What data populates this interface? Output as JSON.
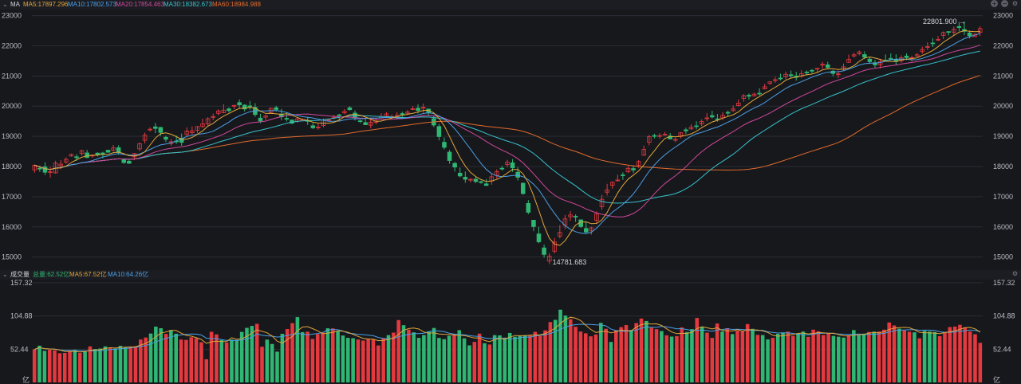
{
  "top_legend": {
    "collapse": "⌄",
    "name": "MA",
    "ma5": "MA5:17897.296",
    "ma10": "MA10:17802.573",
    "ma20": "MA20:17854.463",
    "ma30": "MA30:18382.673",
    "ma60": "MA60:18984.988"
  },
  "bottom_legend": {
    "collapse": "⌄",
    "name": "成交量",
    "total": "总量:62.52亿",
    "ma5": "MA5:67.52亿",
    "ma10": "MA10:64.26亿"
  },
  "colors": {
    "up": "#e3393f",
    "down": "#2fb672",
    "ma5": "#e0a63a",
    "ma10": "#4aa0e8",
    "ma20": "#d0479c",
    "ma30": "#35c2cc",
    "ma60": "#e26a2c",
    "background": "#17181c",
    "grid": "#2a2c33"
  },
  "icons": [
    "plus-circle-icon",
    "minus-circle-icon",
    "settings-icon"
  ],
  "chart_data": [
    {
      "type": "candlestick",
      "y_ticks": [
        "23000",
        "22000",
        "21000",
        "20000",
        "19000",
        "18000",
        "17000",
        "16000",
        "15000"
      ],
      "ylim": [
        14700,
        23200
      ],
      "high_label": "22801.900",
      "low_label": "14781.683",
      "candles": [
        [
          17888,
          18041,
          17796,
          18071
        ],
        [
          17941,
          17932,
          17823,
          18022
        ],
        [
          17986,
          17810,
          17719,
          18140
        ],
        [
          17824,
          17827,
          17629,
          17989
        ],
        [
          17789,
          18110,
          17762,
          18190
        ],
        [
          18027,
          18079,
          17917,
          18213
        ],
        [
          18148,
          18236,
          18095,
          18306
        ],
        [
          18347,
          18400,
          18325,
          18426
        ],
        [
          18323,
          18293,
          18186,
          18409
        ],
        [
          18428,
          18525,
          18361,
          18558
        ],
        [
          18450,
          18298,
          18277,
          18551
        ],
        [
          18347,
          18373,
          18293,
          18397
        ],
        [
          18444,
          18393,
          18332,
          18469
        ],
        [
          18447,
          18445,
          18269,
          18488
        ],
        [
          18539,
          18472,
          18457,
          18551
        ],
        [
          18543,
          18613,
          18489,
          18712
        ],
        [
          18622,
          18460,
          18391,
          18705
        ],
        [
          18222,
          18131,
          18089,
          18263
        ],
        [
          18176,
          18105,
          18087,
          18242
        ],
        [
          18319,
          18426,
          18210,
          18447
        ],
        [
          18583,
          18755,
          18510,
          18798
        ],
        [
          18868,
          19036,
          18763,
          19122
        ],
        [
          19211,
          19236,
          19160,
          19292
        ],
        [
          19314,
          19261,
          19101,
          19443
        ],
        [
          19294,
          19129,
          19016,
          19315
        ],
        [
          18968,
          18902,
          18810,
          19020
        ],
        [
          18761,
          18820,
          18684,
          18910
        ],
        [
          18841,
          18837,
          18748,
          19026
        ],
        [
          18938,
          18801,
          18687,
          19091
        ],
        [
          19056,
          19174,
          19002,
          19298
        ],
        [
          19122,
          19183,
          19046,
          19327
        ],
        [
          19203,
          19324,
          19101,
          19339
        ],
        [
          19324,
          19415,
          19276,
          19584
        ],
        [
          19411,
          19583,
          19348,
          19631
        ],
        [
          19630,
          19653,
          19529,
          19750
        ],
        [
          19761,
          19840,
          19689,
          19892
        ],
        [
          19785,
          19868,
          19766,
          20062
        ],
        [
          19910,
          19851,
          19791,
          19957
        ],
        [
          20022,
          20024,
          19900,
          20049
        ],
        [
          20118,
          20042,
          19938,
          20221
        ],
        [
          20034,
          19905,
          19822,
          20064
        ],
        [
          20009,
          19981,
          19882,
          20174
        ],
        [
          19960,
          19723,
          19650,
          20099
        ],
        [
          19604,
          19506,
          19435,
          19745
        ],
        [
          19635,
          19678,
          19532,
          19718
        ],
        [
          19789,
          19926,
          19753,
          19950
        ],
        [
          19948,
          19888,
          19829,
          20012
        ],
        [
          19738,
          19646,
          19537,
          19909
        ],
        [
          19594,
          19593,
          19492,
          19791
        ],
        [
          19538,
          19436,
          19405,
          19561
        ],
        [
          19497,
          19577,
          19452,
          19618
        ],
        [
          19514,
          19550,
          19505,
          19590
        ],
        [
          19527,
          19495,
          19377,
          19640
        ],
        [
          19350,
          19281,
          19241,
          19440
        ],
        [
          19304,
          19305,
          19223,
          19426
        ],
        [
          19355,
          19545,
          19297,
          19592
        ],
        [
          19524,
          19550,
          19518,
          19578
        ],
        [
          19625,
          19630,
          19568,
          19713
        ],
        [
          19712,
          19687,
          19522,
          19740
        ],
        [
          19776,
          19824,
          19730,
          19905
        ],
        [
          19947,
          19882,
          19856,
          19995
        ],
        [
          19769,
          19613,
          19525,
          19856
        ],
        [
          19515,
          19494,
          19441,
          19538
        ],
        [
          19456,
          19384,
          19374,
          19611
        ],
        [
          19370,
          19471,
          19259,
          19563
        ],
        [
          19461,
          19509,
          19396,
          19612
        ],
        [
          19604,
          19662,
          19609,
          19766
        ],
        [
          19661,
          19742,
          19634,
          19803
        ],
        [
          19620,
          19656,
          19561,
          19723
        ],
        [
          19654,
          19698,
          19564,
          19803
        ],
        [
          19753,
          19747,
          19647,
          19821
        ],
        [
          19764,
          19803,
          19704,
          19870
        ],
        [
          19891,
          19916,
          19866,
          19998
        ],
        [
          19933,
          19859,
          19757,
          20060
        ],
        [
          19926,
          19969,
          19785,
          20084
        ],
        [
          19904,
          19774,
          19674,
          19911
        ],
        [
          19584,
          19373,
          19308,
          19676
        ],
        [
          19325,
          18992,
          18868,
          19413
        ],
        [
          18802,
          18635,
          18565,
          18960
        ],
        [
          18475,
          18198,
          18089,
          18549
        ],
        [
          18103,
          17981,
          17833,
          18154
        ],
        [
          17779,
          17687,
          17641,
          17962
        ],
        [
          17646,
          17577,
          17459,
          17834
        ],
        [
          17559,
          17573,
          17475,
          17615
        ],
        [
          17581,
          17502,
          17454,
          17646
        ],
        [
          17496,
          17492,
          17432,
          17533
        ],
        [
          17425,
          17374,
          17351,
          17582
        ],
        [
          17519,
          17658,
          17393,
          17777
        ],
        [
          17705,
          17828,
          17591,
          17906
        ],
        [
          17942,
          17934,
          17862,
          18015
        ],
        [
          18066,
          18141,
          17975,
          18218
        ],
        [
          18121,
          17955,
          17823,
          18245
        ],
        [
          17809,
          17643,
          17537,
          17977
        ],
        [
          17446,
          17102,
          17067,
          17471
        ],
        [
          16777,
          16483,
          16419,
          16887
        ],
        [
          16219,
          16010,
          15857,
          16228
        ],
        [
          15766,
          15503,
          15459,
          15993
        ],
        [
          15303,
          15087,
          14982,
          15414
        ],
        [
          14866,
          15029,
          14764,
          15124
        ],
        [
          15193,
          15497,
          15122,
          15625
        ],
        [
          15693,
          15814,
          15619,
          16063
        ],
        [
          16053,
          16264,
          15928,
          16395
        ],
        [
          16335,
          16394,
          16200,
          16519
        ],
        [
          16351,
          16324,
          16166,
          16411
        ],
        [
          16233,
          16010,
          15964,
          16244
        ],
        [
          15946,
          15829,
          15793,
          16167
        ],
        [
          15867,
          15966,
          15742,
          16004
        ],
        [
          16214,
          16438,
          16125,
          16512
        ],
        [
          16670,
          16915,
          16561,
          17057
        ],
        [
          17148,
          17226,
          17040,
          17424
        ],
        [
          17378,
          17476,
          17265,
          17506
        ],
        [
          17538,
          17552,
          17500,
          17730
        ],
        [
          17722,
          17716,
          17555,
          17805
        ],
        [
          17824,
          17940,
          17780,
          18012
        ],
        [
          17931,
          17885,
          17785,
          18040
        ],
        [
          18041,
          18162,
          17955,
          18212
        ],
        [
          18375,
          18563,
          18349,
          18692
        ],
        [
          18801,
          18985,
          18698,
          19046
        ],
        [
          19025,
          19004,
          18932,
          19087
        ],
        [
          18998,
          19024,
          18926,
          19103
        ],
        [
          19050,
          19067,
          19018,
          19144
        ],
        [
          19011,
          18913,
          18898,
          19108
        ],
        [
          18881,
          18897,
          18809,
          18956
        ],
        [
          18996,
          19116,
          18927,
          19139
        ],
        [
          19215,
          19180,
          19080,
          19285
        ],
        [
          19245,
          19304,
          19217,
          19400
        ],
        [
          19347,
          19334,
          19233,
          19497
        ],
        [
          19413,
          19490,
          19338,
          19561
        ],
        [
          19583,
          19611,
          19501,
          19767
        ],
        [
          19687,
          19641,
          19591,
          19848
        ],
        [
          19577,
          19575,
          19485,
          19741
        ],
        [
          19609,
          19692,
          19544,
          19797
        ],
        [
          19795,
          19766,
          19648,
          19855
        ],
        [
          19852,
          19907,
          19811,
          20024
        ],
        [
          20017,
          20099,
          19992,
          20219
        ],
        [
          20253,
          20347,
          20144,
          20399
        ],
        [
          20361,
          20327,
          20216,
          20421
        ],
        [
          20342,
          20398,
          20320,
          20447
        ],
        [
          20428,
          20414,
          20353,
          20589
        ],
        [
          20570,
          20642,
          20556,
          20740
        ],
        [
          20750,
          20805,
          20708,
          20820
        ],
        [
          20847,
          20876,
          20776,
          20969
        ],
        [
          20930,
          20912,
          20853,
          21076
        ],
        [
          20970,
          21056,
          20890,
          21145
        ],
        [
          21041,
          21004,
          20939,
          21181
        ],
        [
          20998,
          20955,
          20844,
          21134
        ],
        [
          20989,
          21076,
          20942,
          21191
        ],
        [
          21128,
          21114,
          21024,
          21182
        ],
        [
          21186,
          21176,
          21088,
          21230
        ],
        [
          21225,
          21252,
          21114,
          21269
        ],
        [
          21360,
          21385,
          21241,
          21465
        ],
        [
          21367,
          21286,
          21224,
          21469
        ],
        [
          21160,
          21083,
          20987,
          21200
        ],
        [
          21045,
          21071,
          20930,
          21181
        ],
        [
          21225,
          21301,
          21174,
          21410
        ],
        [
          21453,
          21550,
          21431,
          21710
        ],
        [
          21663,
          21701,
          21608,
          21770
        ],
        [
          21733,
          21798,
          21686,
          21844
        ],
        [
          21708,
          21624,
          21558,
          21815
        ],
        [
          21557,
          21472,
          21396,
          21637
        ],
        [
          21439,
          21367,
          21272,
          21536
        ],
        [
          21370,
          21479,
          21251,
          21569
        ],
        [
          21524,
          21521,
          21474,
          21711
        ],
        [
          21582,
          21568,
          21525,
          21745
        ],
        [
          21539,
          21478,
          21354,
          21719
        ],
        [
          21504,
          21605,
          21439,
          21686
        ],
        [
          21659,
          21609,
          21527,
          21747
        ],
        [
          21593,
          21608,
          21478,
          21671
        ],
        [
          21660,
          21700,
          21656,
          21763
        ],
        [
          21809,
          21876,
          21730,
          21967
        ],
        [
          21965,
          21971,
          21854,
          22121
        ],
        [
          22093,
          22079,
          21955,
          22253
        ],
        [
          22189,
          22213,
          22154,
          22322
        ],
        [
          22343,
          22439,
          22222,
          22474
        ],
        [
          22470,
          22446,
          22340,
          22480
        ],
        [
          22451,
          22545,
          22339,
          22636
        ],
        [
          22637,
          22604,
          22476,
          22787
        ],
        [
          22541,
          22480,
          22354,
          22802
        ],
        [
          22424,
          22332,
          22244,
          22502
        ],
        [
          22301,
          22381,
          22298,
          22403
        ],
        [
          22447,
          22570,
          22326,
          22645
        ]
      ],
      "lines": [
        "ma5",
        "ma10",
        "ma20",
        "ma30",
        "ma60"
      ]
    },
    {
      "type": "bar",
      "y_ticks": [
        "157.32",
        "104.88",
        "52.44"
      ],
      "unit": "亿",
      "ylim": [
        0,
        157.32
      ],
      "volumes": [
        52.1,
        58.0,
        49.9,
        51.6,
        50.7,
        46.1,
        46.6,
        49.9,
        51.7,
        46.7,
        48.3,
        56.9,
        52.7,
        53.5,
        56.8,
        54.6,
        53.5,
        57.8,
        55.4,
        56.8,
        57.1,
        67.8,
        70.9,
        77.2,
        88.1,
        85.6,
        76.6,
        82.8,
        76.9,
        67.7,
        67.1,
        71.3,
        69.8,
        63.5,
        36.6,
        80.0,
        75.8,
        66.8,
        62.9,
        67.7,
        67.0,
        79.8,
        86.2,
        89.2,
        92.5,
        56.4,
        67.6,
        60.7,
        48.6,
        76.8,
        84.3,
        93.6,
        103.1,
        79.4,
        80.1,
        68.7,
        76.3,
        79.1,
        85.5,
        85.3,
        80.7,
        74.1,
        70.4,
        69.8,
        67.8,
        66.1,
        69.1,
        68.4,
        58.4,
        69.8,
        74.7,
        78.6,
        98.5,
        90.4,
        83.4,
        79.1,
        70.4,
        74.8,
        80.8,
        86.0,
        70.3,
        68.3,
        73.8,
        76.0,
        82.5,
        69.6,
        58.5,
        64.0,
        77.1,
        61.9,
        59.9,
        74.7,
        74.3,
        70.7,
        78.1,
        72.1,
        73.4,
        74.7,
        74.6,
        79.9,
        73.6,
        82.2,
        95.3,
        98.8,
        114.9,
        105.6,
        99.9,
        87.9,
        80.4,
        77.5,
        72.8,
        75.7,
        94.1,
        84.7,
        63.9,
        82.5,
        87.3,
        90.6,
        82.8,
        93.7,
        100.9,
        97.0,
        86.6,
        84.1,
        81.1,
        74.4,
        72.4,
        73.1,
        86.8,
        79.6,
        84.1,
        101.8,
        87.7,
        78.6,
        70.3,
        93.1,
        80.3,
        85.6,
        76.3,
        81.9,
        80.5,
        92.1,
        84.6,
        75.1,
        74.8,
        67.9,
        70.4,
        76.7,
        78.8,
        80.2,
        73.5,
        77.5,
        80.3,
        72.0,
        83.3,
        80.7,
        74.8,
        76.9,
        73.4,
        72.2,
        70.8,
        74.5,
        82.7,
        74.2,
        77.0,
        79.7,
        80.2,
        80.3,
        83.3,
        94.7,
        90.0,
        84.9,
        82.2,
        80.0,
        79.1,
        69.7,
        81.5,
        80.4,
        79.6,
        73.1,
        79.2,
        87.4,
        88.2,
        91.0,
        86.9,
        80.5,
        76.1,
        62.5
      ],
      "lines": [
        "ma5",
        "ma10"
      ]
    }
  ]
}
